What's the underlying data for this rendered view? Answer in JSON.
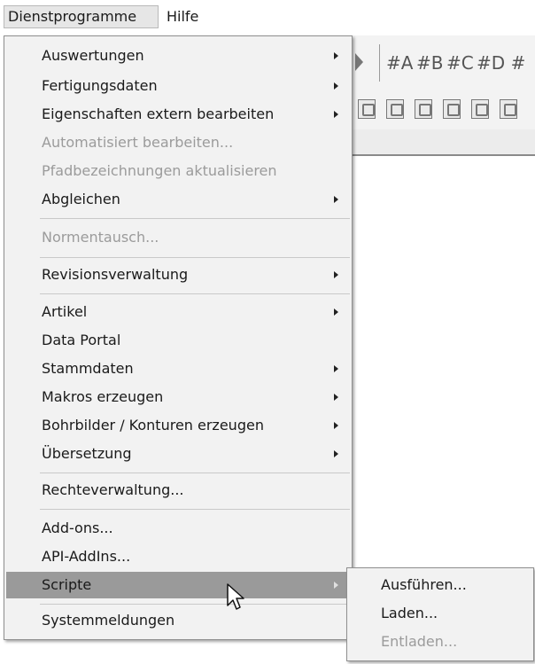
{
  "menubar": {
    "dienstprogramme": "Dienstprogramme",
    "hilfe": "Hilfe"
  },
  "toolbar": {
    "icons": [
      "#A",
      "#B",
      "#C",
      "#D",
      "#"
    ]
  },
  "menu": {
    "auswertungen": "Auswertungen",
    "fertigungsdaten": "Fertigungsdaten",
    "eigenschaften": "Eigenschaften extern bearbeiten",
    "automatisiert": "Automatisiert bearbeiten...",
    "pfadbezeichnungen": "Pfadbezeichnungen aktualisieren",
    "abgleichen": "Abgleichen",
    "normentausch": "Normentausch...",
    "revisionsverwaltung": "Revisionsverwaltung",
    "artikel": "Artikel",
    "data_portal": "Data Portal",
    "stammdaten": "Stammdaten",
    "makros": "Makros erzeugen",
    "bohrbilder": "Bohrbilder / Konturen erzeugen",
    "uebersetzung": "Übersetzung",
    "rechteverwaltung": "Rechteverwaltung...",
    "addons": "Add-ons...",
    "api_addins": "API-AddIns...",
    "scripte": "Scripte",
    "systemmeldungen": "Systemmeldungen"
  },
  "submenu": {
    "ausfuehren": "Ausführen...",
    "laden": "Laden...",
    "entladen": "Entladen..."
  },
  "colors": {
    "menu_bg": "#f2f2f2",
    "highlight": "#9a9a9a",
    "disabled": "#9b9b9b"
  }
}
